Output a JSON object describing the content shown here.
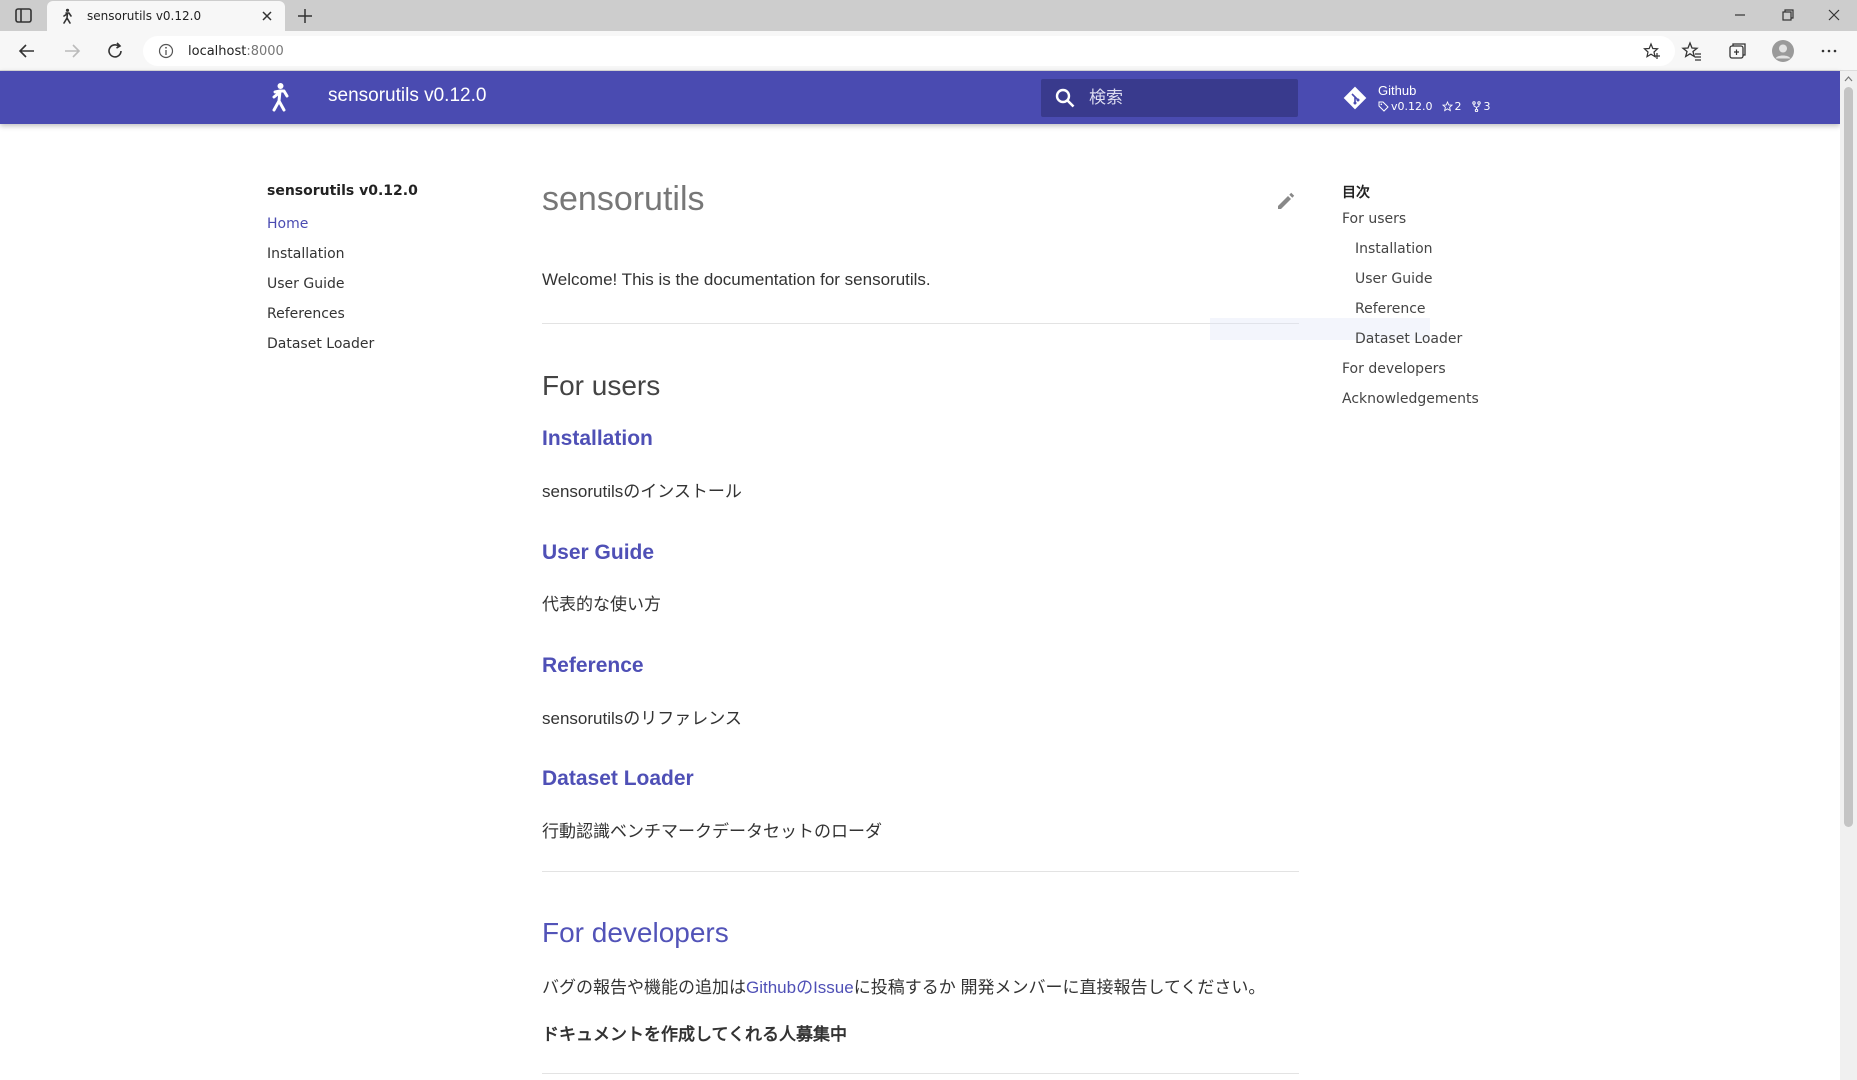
{
  "browser": {
    "tab_title": "sensorutils v0.12.0",
    "url_host": "localhost",
    "url_port": ":8000"
  },
  "header": {
    "site_title": "sensorutils v0.12.0",
    "search_placeholder": "検索",
    "repo": {
      "name": "Github",
      "version": "v0.12.0",
      "stars": "2",
      "forks": "3"
    }
  },
  "leftnav": {
    "title": "sensorutils v0.12.0",
    "items": [
      {
        "label": "Home",
        "active": true
      },
      {
        "label": "Installation"
      },
      {
        "label": "User Guide"
      },
      {
        "label": "References"
      },
      {
        "label": "Dataset Loader"
      }
    ]
  },
  "main": {
    "title": "sensorutils",
    "welcome": "Welcome! This is the documentation for sensorutils.",
    "for_users": {
      "heading": "For users",
      "sections": [
        {
          "title": "Installation",
          "desc": "sensorutilsのインストール"
        },
        {
          "title": "User Guide",
          "desc": "代表的な使い方"
        },
        {
          "title": "Reference",
          "desc": "sensorutilsのリファレンス"
        },
        {
          "title": "Dataset Loader",
          "desc": "行動認識ベンチマークデータセットのローダ"
        }
      ]
    },
    "for_developers": {
      "heading": "For developers",
      "text_before": "バグの報告や機能の追加は",
      "link": "GithubのIssue",
      "text_after": "に投稿するか 開発メンバーに直接報告してください。",
      "recruit": "ドキュメントを作成してくれる人募集中"
    }
  },
  "toc": {
    "title": "目次",
    "items": [
      {
        "label": "For users",
        "level": 1
      },
      {
        "label": "Installation",
        "level": 2
      },
      {
        "label": "User Guide",
        "level": 2
      },
      {
        "label": "Reference",
        "level": 2
      },
      {
        "label": "Dataset Loader",
        "level": 2
      },
      {
        "label": "For developers",
        "level": 1
      },
      {
        "label": "Acknowledgements",
        "level": 1
      }
    ]
  },
  "colors": {
    "primary": "#4a4bb1",
    "link": "#4f50b6"
  }
}
